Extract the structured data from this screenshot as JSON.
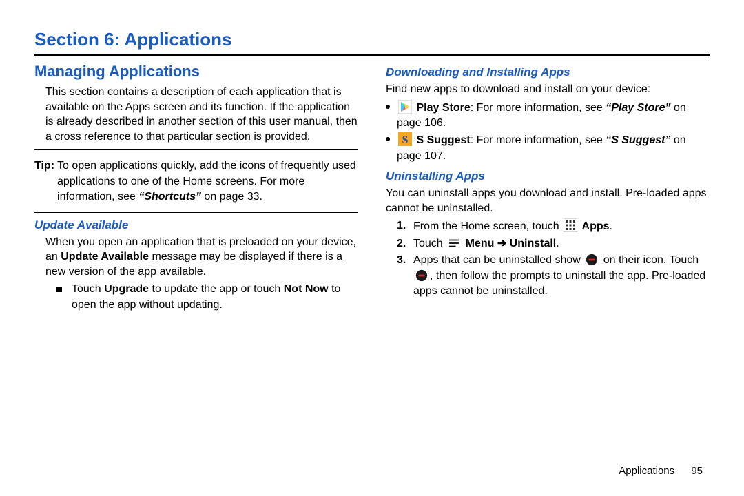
{
  "section_title": "Section 6: Applications",
  "left": {
    "h2": "Managing Applications",
    "intro": "This section contains a description of each application that is available on the Apps screen and its function. If the application is already described in another section of this user manual, then a cross reference to that particular section is provided.",
    "tip_label": "Tip:",
    "tip_body_a": "To open applications quickly, add the icons of frequently used applications to one of the Home screens. For more information, see ",
    "tip_ref": "“Shortcuts”",
    "tip_body_b": " on page 33.",
    "h3_update": "Update Available",
    "update_p_a": "When you open an application that is preloaded on your device, an ",
    "update_p_bold": "Update Available",
    "update_p_b": " message may be displayed if there is a new version of the app available.",
    "update_bullet_a": "Touch ",
    "update_bullet_b1": "Upgrade",
    "update_bullet_c": " to update the app or touch ",
    "update_bullet_b2": "Not Now",
    "update_bullet_d": " to open the app without updating."
  },
  "right": {
    "h3_download": "Downloading and Installing Apps",
    "download_intro": "Find new apps to download and install on your device:",
    "play_bold": "Play Store",
    "play_text_a": ": For more information, see ",
    "play_ref": "“Play Store”",
    "play_text_b": " on page 106.",
    "suggest_bold": "S Suggest",
    "suggest_text_a": ": For more information, see ",
    "suggest_ref": "“S Suggest”",
    "suggest_text_b": " on page 107.",
    "h3_uninstall": "Uninstalling Apps",
    "uninstall_intro": "You can uninstall apps you download and install. Pre-loaded apps cannot be uninstalled.",
    "step1_a": "From the Home screen, touch ",
    "step1_bold": "Apps",
    "step1_b": ".",
    "step2_a": "Touch ",
    "step2_bold": "Menu ➔ Uninstall",
    "step2_b": ".",
    "step3_a": "Apps that can be uninstalled show ",
    "step3_b": " on their icon. Touch ",
    "step3_c": ", then follow the prompts to uninstall the app. Pre-loaded apps cannot be uninstalled.",
    "num1": "1.",
    "num2": "2.",
    "num3": "3."
  },
  "footer": {
    "label": "Applications",
    "page": "95"
  }
}
